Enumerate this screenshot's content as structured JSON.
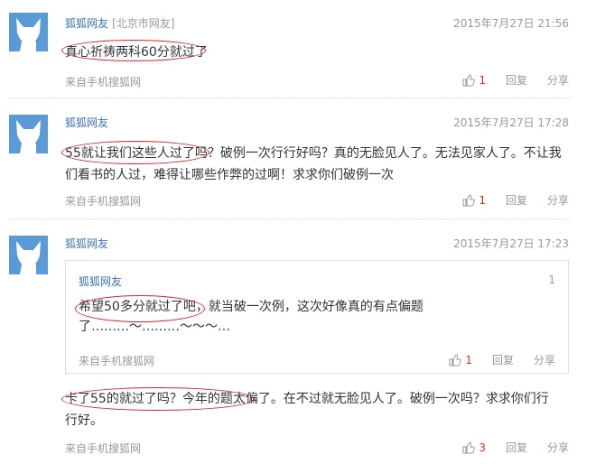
{
  "comments": [
    {
      "user": "狐狐网友",
      "location": "[北京市网友]",
      "time": "2015年7月27日 21:56",
      "text": "真心祈祷两科60分就过了",
      "source": "来自手机搜狐网",
      "likes": "1",
      "reply": "回复",
      "share": "分享"
    },
    {
      "user": "狐狐网友",
      "time": "2015年7月27日 17:28",
      "text": "55就让我们这些人过了吗？破例一次行行好吗？真的无脸见人了。无法见家人了。不让我们看书的人过，难得让哪些作弊的过啊！求求你们破例一次",
      "source": "来自手机搜狐网",
      "likes": "1",
      "reply": "回复",
      "share": "分享"
    },
    {
      "user": "狐狐网友",
      "time": "2015年7月27日 17:23",
      "quote": {
        "user": "狐狐网友",
        "floor": "1",
        "text": "希望50多分就过了吧，就当破一次例，这次好像真的有点偏题了………～………～～～…",
        "source": "来自手机搜狐网",
        "likes": "1",
        "reply": "回复",
        "share": "分享"
      },
      "text": "卡了55的就过了吗？今年的题太偏了。在不过就无脸见人了。破例一次吗？求求你们行行好。",
      "source": "来自手机搜狐网",
      "likes": "3",
      "reply": "回复",
      "share": "分享"
    }
  ],
  "colors": {
    "username": "#3a72b6",
    "meta": "#999999",
    "like_count": "#d6351e",
    "annotation": "#d9272e",
    "avatar_bg": "#5b9bd5"
  },
  "icons": {
    "avatar": "fox-avatar-icon",
    "like": "thumbs-up-icon"
  }
}
